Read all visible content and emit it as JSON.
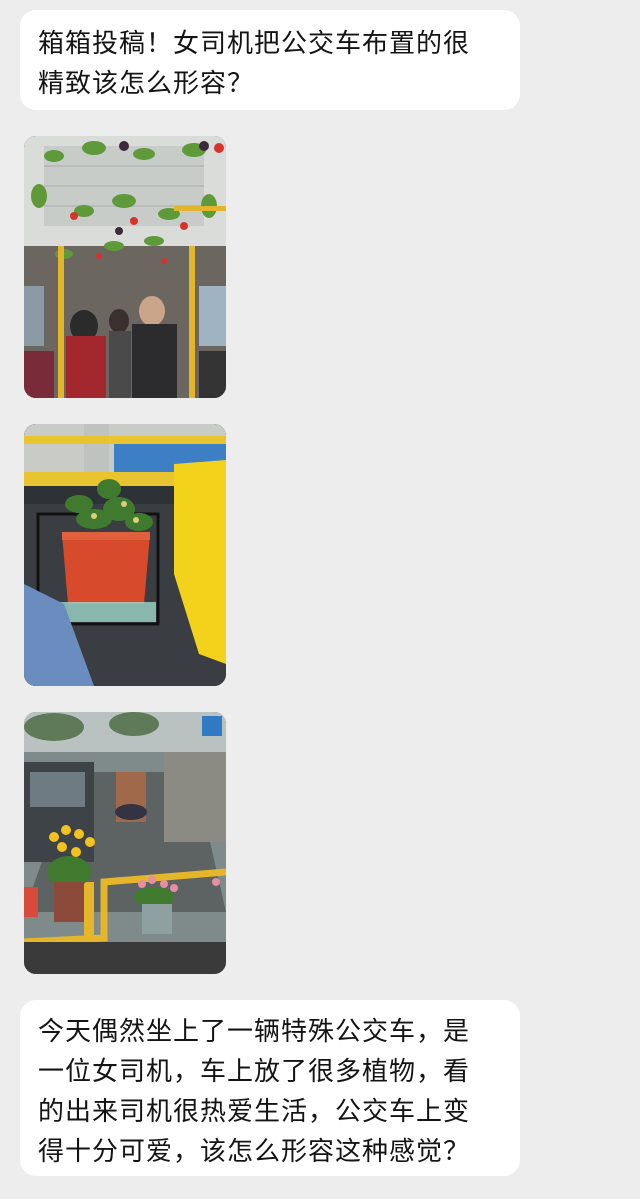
{
  "messages": [
    {
      "lines": [
        "箱箱投稿！女司机把公交车布置的很",
        "精致该怎么形容？"
      ]
    },
    {
      "images": [
        {
          "icon": "bus-interior-vines-photo"
        },
        {
          "icon": "potted-plant-on-rail-photo"
        },
        {
          "icon": "windshield-flowers-street-photo"
        }
      ]
    },
    {
      "lines": [
        "今天偶然坐上了一辆特殊公交车，是",
        "一位女司机，车上放了很多植物，看",
        "的出来司机很热爱生活，公交车上变",
        "得十分可爱，该怎么形容这种感觉？"
      ]
    }
  ],
  "colors": {
    "background": "#ededed",
    "bubble": "#ffffff",
    "text": "#141414"
  }
}
